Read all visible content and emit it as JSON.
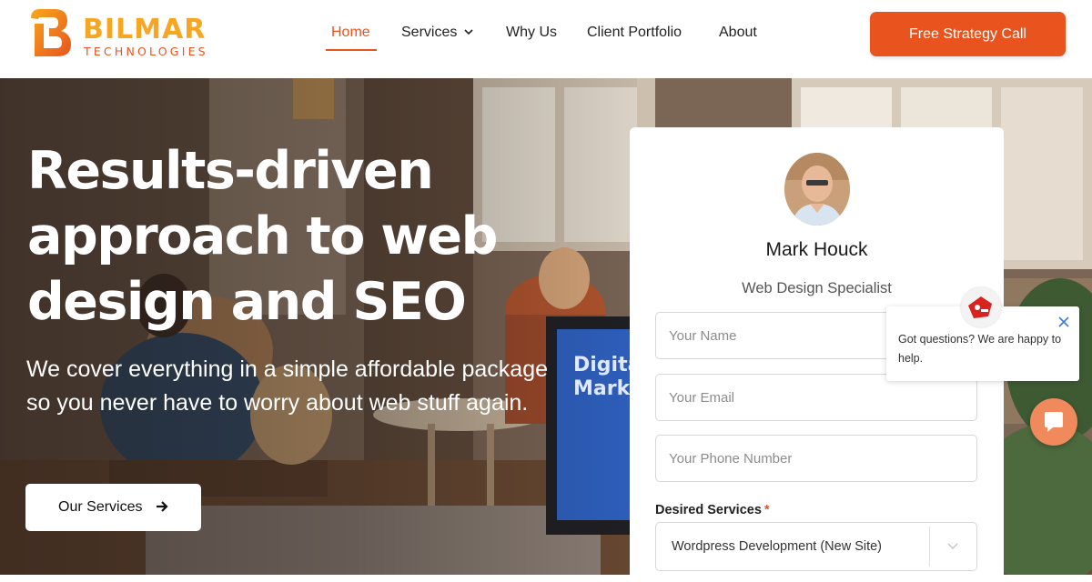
{
  "brand": {
    "name": "BILMAR",
    "subtitle": "TECHNOLOGIES",
    "colors": {
      "orange": "#e9531d",
      "yellow": "#f6a623"
    }
  },
  "nav": {
    "items": [
      {
        "label": "Home",
        "active": true
      },
      {
        "label": "Services",
        "has_dropdown": true
      },
      {
        "label": "Why Us"
      },
      {
        "label": "Client Portfolio"
      },
      {
        "label": "About"
      }
    ],
    "cta_label": "Free Strategy Call"
  },
  "hero": {
    "headline": "Results-driven approach to web design and SEO",
    "subtext": "We cover everything in a simple affordable package so you never have to worry about web stuff again.",
    "button_label": "Our Services",
    "button_icon": "arrow-right-icon",
    "monitor_text": "Digital Mark"
  },
  "form": {
    "name": "Mark Houck",
    "role": "Web Design Specialist",
    "name_placeholder": "Your Name",
    "email_placeholder": "Your Email",
    "phone_placeholder": "Your Phone Number",
    "services_label": "Desired Services",
    "required_mark": "*",
    "services_value": "Wordpress Development (New Site)"
  },
  "chat": {
    "message": "Got questions? We are happy to help.",
    "close_icon": "close-icon",
    "launcher_icon": "chat-icon"
  }
}
